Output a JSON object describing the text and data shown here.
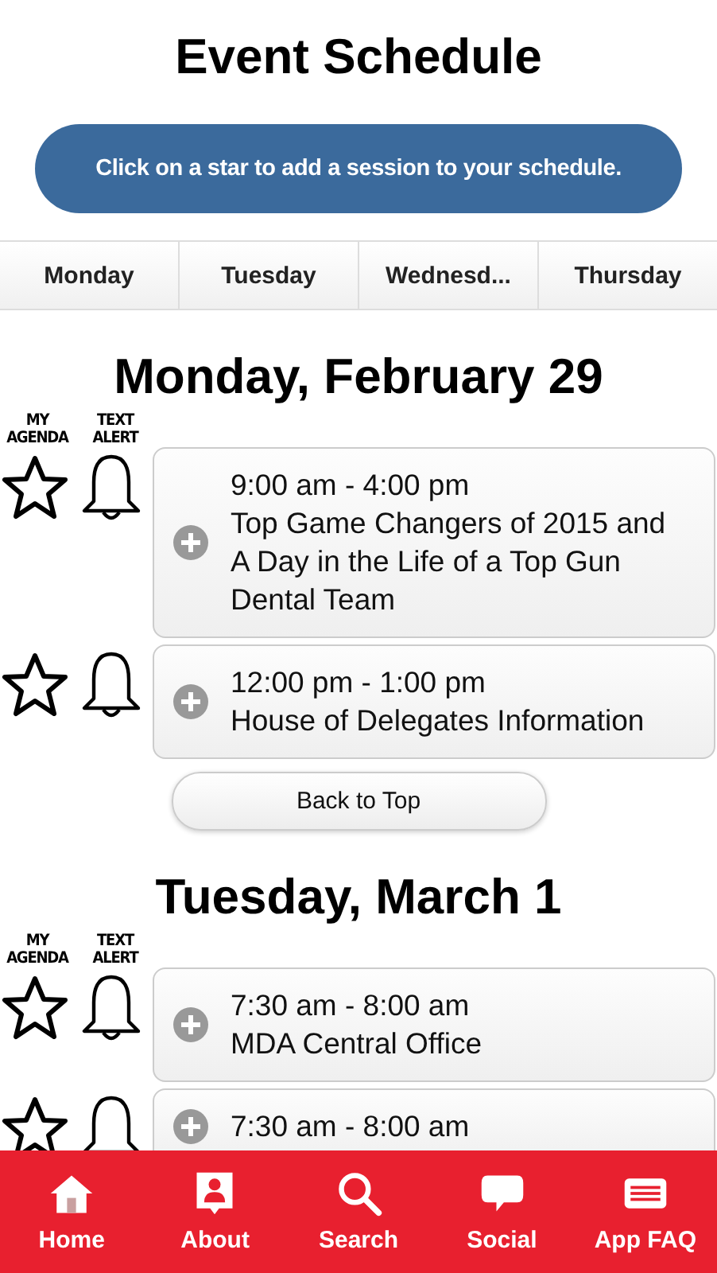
{
  "title": "Event Schedule",
  "banner": "Click on a star to add a session to your schedule.",
  "tabs": [
    {
      "label": "Monday",
      "selected": false
    },
    {
      "label": "Tuesday",
      "selected": false
    },
    {
      "label": "Wednesd...",
      "selected": false
    },
    {
      "label": "Thursday",
      "selected": false
    }
  ],
  "days": [
    {
      "heading": "Monday, February 29",
      "agenda_label": "MY AGENDA",
      "alert_label": "TEXT ALERT",
      "sessions": [
        {
          "time": "9:00 am - 4:00 pm",
          "title": "Top Game Changers of 2015 and A Day in the Life of a Top Gun Dental Team",
          "starred": false,
          "alert": false
        },
        {
          "time": "12:00 pm - 1:00 pm",
          "title": "House of Delegates Information",
          "starred": false,
          "alert": false
        }
      ],
      "back_button": "Back to Top"
    },
    {
      "heading": "Tuesday, March 1",
      "agenda_label": "MY AGENDA",
      "alert_label": "TEXT ALERT",
      "sessions": [
        {
          "time": "7:30 am - 8:00 am",
          "title": "MDA Central Office",
          "starred": false,
          "alert": false
        },
        {
          "time": "7:30 am - 8:00 am",
          "starred": false,
          "alert": false
        }
      ]
    }
  ],
  "nav": [
    {
      "label": "Home",
      "kind": "home"
    },
    {
      "label": "About",
      "kind": "about"
    },
    {
      "label": "Search",
      "kind": "search"
    },
    {
      "label": "Social",
      "kind": "social"
    },
    {
      "label": "App FAQ",
      "kind": "faq"
    }
  ]
}
